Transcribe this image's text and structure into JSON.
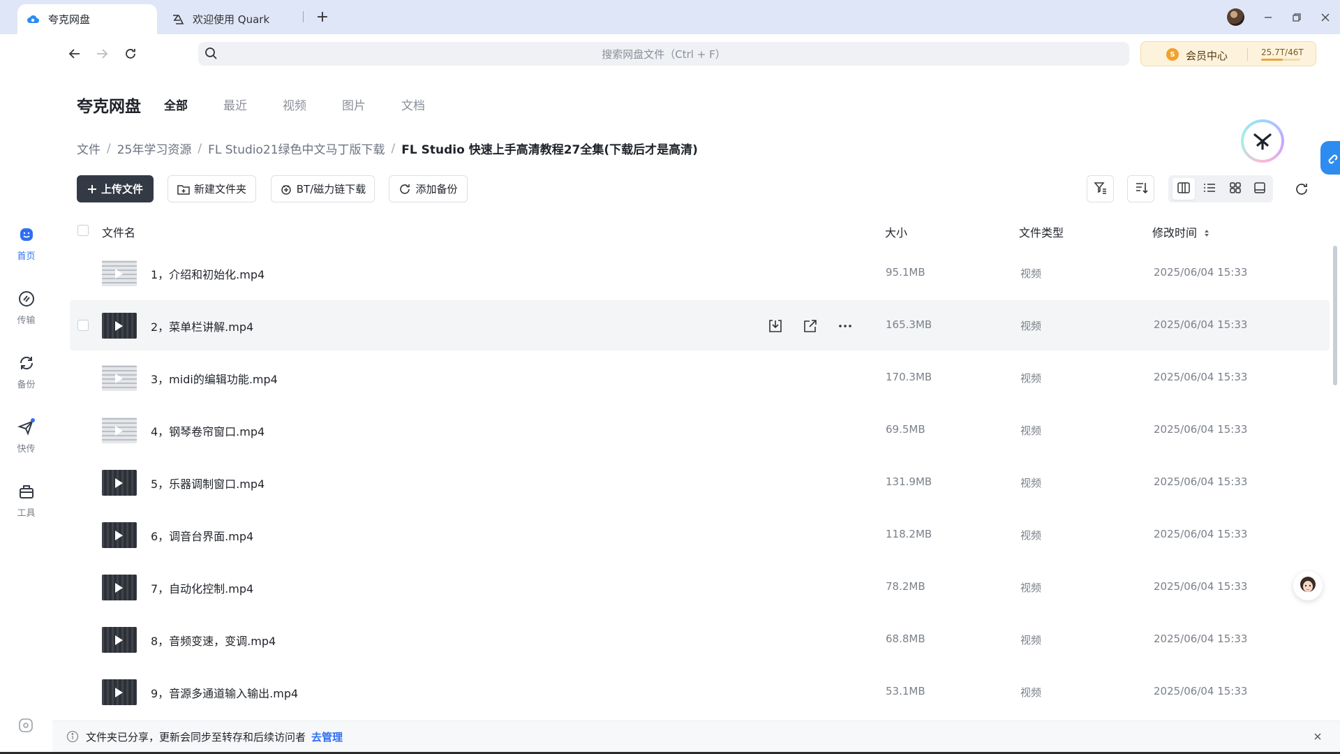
{
  "tabs": [
    {
      "label": "夸克网盘",
      "active": true
    },
    {
      "label": "欢迎使用 Quark",
      "active": false
    }
  ],
  "search": {
    "placeholder": "搜索网盘文件（Ctrl + F）"
  },
  "member": {
    "label": "会员中心",
    "quota": "25.7T/46T",
    "quota_fraction": 0.56
  },
  "sidebar": {
    "items": [
      {
        "label": "首页",
        "icon": "home-icon",
        "active": true
      },
      {
        "label": "传输",
        "icon": "transfer-icon",
        "active": false
      },
      {
        "label": "备份",
        "icon": "backup-icon",
        "active": false
      },
      {
        "label": "快传",
        "icon": "quick-send-icon",
        "active": false,
        "badge": true
      },
      {
        "label": "工具",
        "icon": "tools-icon",
        "active": false
      }
    ]
  },
  "header": {
    "title": "夸克网盘",
    "categories": [
      "全部",
      "最近",
      "视频",
      "图片",
      "文档"
    ],
    "active_category": "全部"
  },
  "breadcrumb": [
    "文件",
    "25年学习资源",
    "FL Studio21绿色中文马丁版下载",
    "FL Studio 快速上手高清教程27全集(下载后才是高清)"
  ],
  "toolbar": {
    "upload": "上传文件",
    "new_folder": "新建文件夹",
    "bt": "BT/磁力链下载",
    "backup": "添加备份"
  },
  "table": {
    "columns": {
      "name": "文件名",
      "size": "大小",
      "type": "文件类型",
      "modified": "修改时间"
    },
    "rows": [
      {
        "name": "1，介绍和初始化.mp4",
        "size": "95.1MB",
        "type": "视频",
        "modified": "2025/06/04 15:33"
      },
      {
        "name": "2，菜单栏讲解.mp4",
        "size": "165.3MB",
        "type": "视频",
        "modified": "2025/06/04 15:33"
      },
      {
        "name": "3，midi的编辑功能.mp4",
        "size": "170.3MB",
        "type": "视频",
        "modified": "2025/06/04 15:33"
      },
      {
        "name": "4，钢琴卷帘窗口.mp4",
        "size": "69.5MB",
        "type": "视频",
        "modified": "2025/06/04 15:33"
      },
      {
        "name": "5，乐器调制窗口.mp4",
        "size": "131.9MB",
        "type": "视频",
        "modified": "2025/06/04 15:33"
      },
      {
        "name": "6，调音台界面.mp4",
        "size": "118.2MB",
        "type": "视频",
        "modified": "2025/06/04 15:33"
      },
      {
        "name": "7，自动化控制.mp4",
        "size": "78.2MB",
        "type": "视频",
        "modified": "2025/06/04 15:33"
      },
      {
        "name": "8，音频变速，变调.mp4",
        "size": "68.8MB",
        "type": "视频",
        "modified": "2025/06/04 15:33"
      },
      {
        "name": "9，音源多通道输入输出.mp4",
        "size": "53.1MB",
        "type": "视频",
        "modified": "2025/06/04 15:33"
      }
    ]
  },
  "notice": {
    "text": "文件夹已分享，更新会同步至转存和后续访问者",
    "link": "去管理"
  },
  "colors": {
    "accent": "#2e6ff2",
    "primary_button": "#333a45",
    "member_gold": "#f0a22c"
  }
}
